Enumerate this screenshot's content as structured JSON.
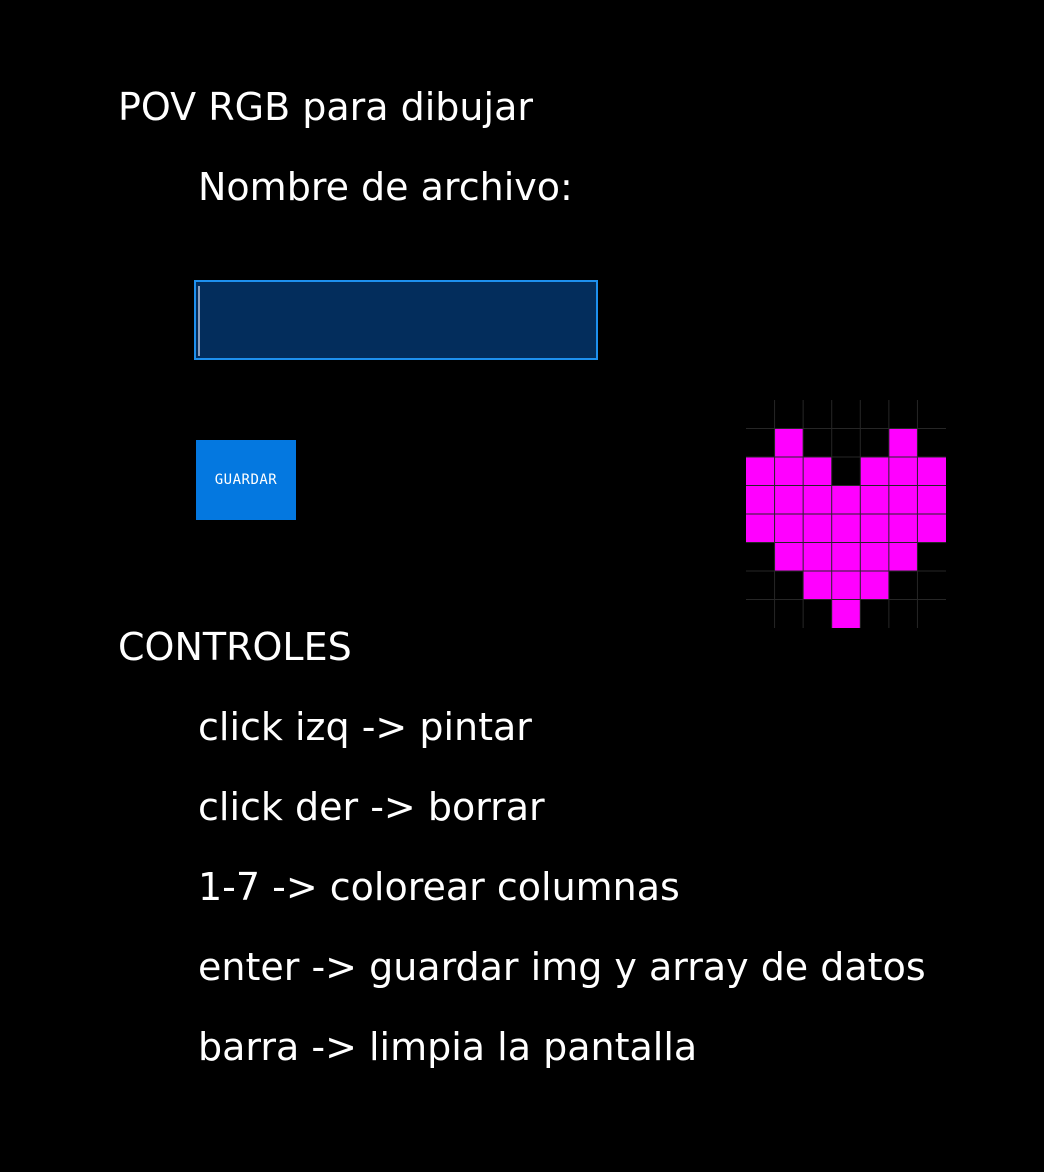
{
  "app": {
    "title": "POV RGB para dibujar"
  },
  "file": {
    "label": "Nombre de archivo:",
    "value": "",
    "save_label": "GUARDAR"
  },
  "controls": {
    "title": "CONTROLES",
    "lines": [
      "click izq -> pintar",
      "click der -> borrar",
      "1-7 -> colorear columnas",
      "enter -> guardar img y array de datos",
      "barra -> limpia la pantalla"
    ]
  },
  "canvas": {
    "columns": 7,
    "rows": 8,
    "paint_color": "#ff00ff",
    "grid_color": "#262626",
    "background_color": "#000000",
    "pixels": [
      [
        0,
        0,
        0,
        0,
        0,
        0,
        0
      ],
      [
        0,
        1,
        0,
        0,
        0,
        1,
        0
      ],
      [
        1,
        1,
        1,
        0,
        1,
        1,
        1
      ],
      [
        1,
        1,
        1,
        1,
        1,
        1,
        1
      ],
      [
        1,
        1,
        1,
        1,
        1,
        1,
        1
      ],
      [
        0,
        1,
        1,
        1,
        1,
        1,
        0
      ],
      [
        0,
        0,
        1,
        1,
        1,
        0,
        0
      ],
      [
        0,
        0,
        0,
        1,
        0,
        0,
        0
      ]
    ]
  },
  "colors": {
    "input_background": "#032d5c",
    "input_border": "#1e90ee",
    "button_background": "#0478e0",
    "text": "#ffffff",
    "page_background": "#000000"
  }
}
